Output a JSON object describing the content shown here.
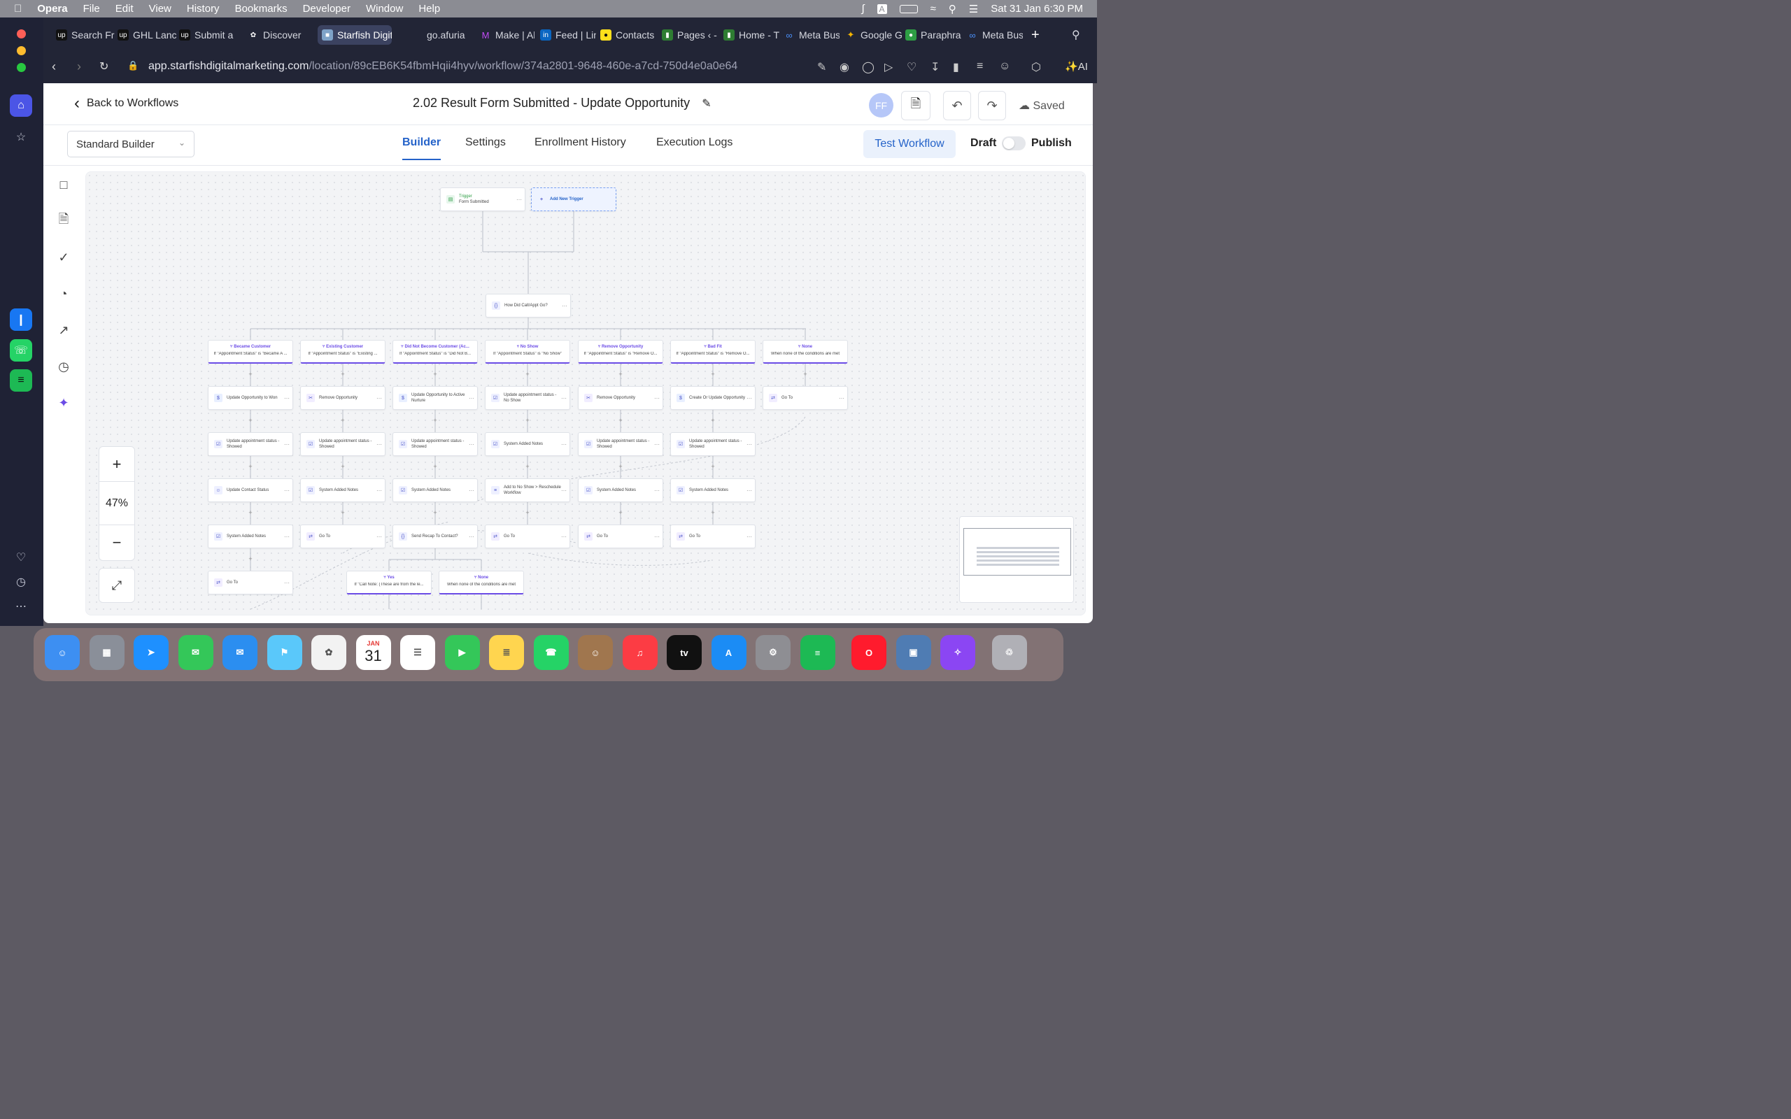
{
  "menubar": {
    "app": "Opera",
    "items": [
      "File",
      "Edit",
      "View",
      "History",
      "Bookmarks",
      "Developer",
      "Window",
      "Help"
    ],
    "datetime": "Sat 31 Jan  6:30 PM",
    "input_badge": "A"
  },
  "tabs": [
    "Search Fr",
    "GHL Lanc",
    "Submit a",
    "Discover",
    "Starfish Digital M",
    "go.afuria",
    "Make | Al",
    "Feed | Lin",
    "Contacts",
    "Pages ‹ -",
    "Home - T",
    "Meta Bus",
    "Google G",
    "Paraphra",
    "Meta Bus"
  ],
  "address": {
    "domain": "app.starfishdigitalmarketing.com",
    "path": "/location/89cEB6K54fbmHqii4hyv/workflow/374a2801-9648-460e-a7cd-750d4e0a0e64",
    "ai_label": "AI"
  },
  "header": {
    "back": "Back to Workflows",
    "title": "2.02 Result Form Submitted - Update Opportunity",
    "avatar": "FF",
    "saved": "Saved"
  },
  "subbar": {
    "builder_select": "Standard Builder",
    "tabs": [
      "Builder",
      "Settings",
      "Enrollment History",
      "Execution Logs"
    ],
    "test": "Test Workflow",
    "draft": "Draft",
    "publish": "Publish"
  },
  "zoom": {
    "plus": "+",
    "level": "47%",
    "minus": "−"
  },
  "trigger": {
    "label": "Trigger",
    "name": "Form Submitted",
    "add": "Add New Trigger"
  },
  "router": "How Did Call/Appt Go?",
  "branches": [
    {
      "title": "Became Customer",
      "cond": "If \"Appointment Status\" is \"Became A ...",
      "steps": [
        "Update Opportunity to Won",
        "Update appointment status - Showed",
        "Update Contact Status",
        "System Added Notes",
        "Go To"
      ]
    },
    {
      "title": "Existing Customer",
      "cond": "If \"Appointment Status\" is \"Existing ...",
      "steps": [
        "Remove Opportunity",
        "Update appointment status - Showed",
        "System Added Notes",
        "Go To"
      ]
    },
    {
      "title": "Did Not Become Customer (Ac...",
      "cond": "If \"Appointment Status\" is \"Did Not B...",
      "steps": [
        "Update Opportunity to Active Nurture",
        "Update appointment status - Showed",
        "System Added Notes",
        "Send Recap To Contact?"
      ]
    },
    {
      "title": "No Show",
      "cond": "If \"Appointment Status\" is \"No Show\"",
      "steps": [
        "Update appointment status - No Show",
        "System Added Notes",
        "Add to No Show > Reschedule Workflow",
        "Go To"
      ]
    },
    {
      "title": "Remove Opportunity",
      "cond": "If \"Appointment Status\" is \"Remove O...",
      "steps": [
        "Remove Opportunity",
        "Update appointment status - Showed",
        "System Added Notes",
        "Go To"
      ]
    },
    {
      "title": "Bad Fit",
      "cond": "If \"Appointment Status\" is \"Remove O...",
      "steps": [
        "Create Or Update Opportunity",
        "Update appointment status - Showed",
        "System Added Notes",
        "Go To"
      ]
    },
    {
      "title": "None",
      "cond": "When none of the conditions are met",
      "steps": [
        "Go To"
      ]
    }
  ],
  "sub_branches": [
    {
      "title": "Yes",
      "cond": "If \"Call Note: (These are from the le..."
    },
    {
      "title": "None",
      "cond": "When none of the conditions are met"
    }
  ],
  "dock": [
    "Finder",
    "Launchpad",
    "Safari",
    "Messages",
    "Mail",
    "Maps",
    "Photos",
    "Calendar",
    "Reminders",
    "FaceTime",
    "Notes",
    "WhatsApp",
    "Contacts",
    "Music",
    "TV",
    "App Store",
    "System Settings",
    "Spotify",
    "Opera",
    "Preview",
    "Setapp",
    "Trash"
  ],
  "dock_calendar": {
    "month": "JAN",
    "day": "31"
  }
}
